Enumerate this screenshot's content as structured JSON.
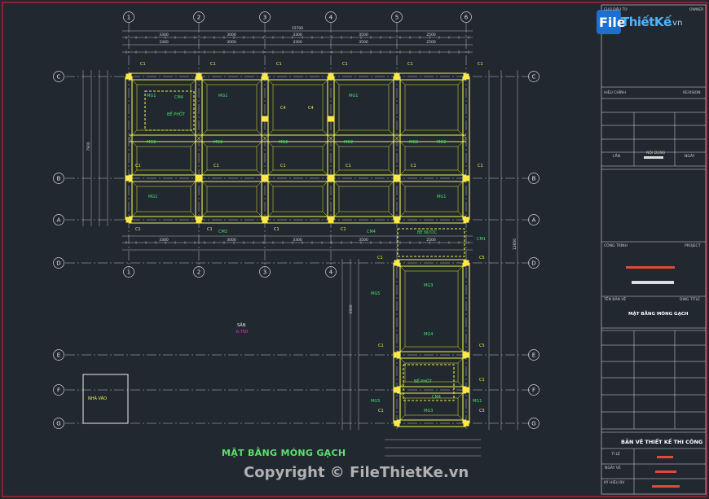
{
  "drawing": {
    "title": "MẶT BẰNG MÓNG GẠCH",
    "copyright": "Copyright © FileThietKe.vn",
    "grid_cols": [
      "1",
      "2",
      "3",
      "4",
      "5",
      "6"
    ],
    "grid_rows": [
      "C",
      "B",
      "A",
      "D",
      "E",
      "F",
      "G"
    ],
    "col_labels": [
      "C1",
      "C1",
      "C1",
      "C1",
      "C1",
      "C1",
      "C4",
      "C4",
      "C1",
      "C1",
      "C1",
      "C1",
      "C1",
      "C1",
      "C1",
      "C1",
      "C1",
      "C1",
      "C1",
      "C5",
      "C1",
      "C1",
      "C5",
      "C1",
      "C5"
    ],
    "beam_labels": [
      "MG1",
      "MG1",
      "MG1",
      "MG2",
      "MG2",
      "MG2",
      "MG2",
      "MG2",
      "MG1",
      "MG1",
      "MG3",
      "MG4",
      "MG5",
      "MG5",
      "MG1",
      "MG3",
      "MG2"
    ],
    "annot": [
      "CM4",
      "BỂ PHỐT",
      "BỂ NƯỚC",
      "BỂ PHỐT",
      "CM4",
      "CM1",
      "CM3",
      "CM4"
    ],
    "level_label": "SÂN",
    "level_value": "-0.750",
    "side_label": "NHÀ VÀO",
    "top_dims_total": "15700",
    "top_dims": [
      "3300",
      "3000",
      "3300",
      "3500",
      "2500"
    ],
    "right_dims": [
      "7900",
      "12850"
    ]
  },
  "logo": {
    "fl": "File",
    "rest": "ThiếtKế",
    "dom": ".vn"
  },
  "titleblock": {
    "owner_label": "CHỦ ĐẦU TƯ",
    "owner_sub": "OWNER",
    "check_label": "HIỆU CHỈNH",
    "rev_label": "REVISION",
    "times_label": "LẦN",
    "content_label": "NỘI DUNG",
    "date_label": "NGÀY",
    "project_label": "CÔNG TRÌNH",
    "project_sub": "PROJECT",
    "drawing_name_label": "TÊN BẢN VẼ",
    "drawing_title_label": "DWG TITLE",
    "drawing_name": "MẶT BẰNG MÓNG GẠCH",
    "stage": "BẢN VẼ THIẾT KẾ THI CÔNG",
    "scale_label": "TỈ LỆ",
    "date2_label": "NGÀY VẼ",
    "sheet_label": "KÝ HIỆU BV"
  }
}
